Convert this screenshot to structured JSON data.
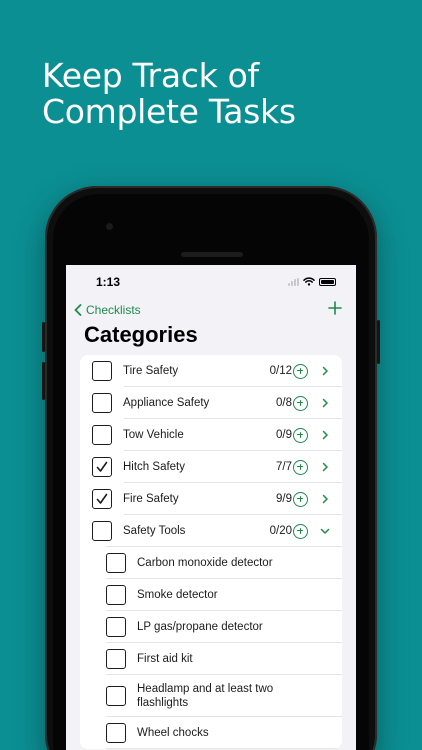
{
  "headline": {
    "line1": "Keep Track of",
    "line2": "Complete Tasks"
  },
  "status_bar": {
    "time": "1:13"
  },
  "nav": {
    "back_label": "Checklists",
    "title": "Categories"
  },
  "icons": {
    "back": "chevron-left-icon",
    "add": "plus-icon",
    "item_add": "plus-circle-icon",
    "disclosure": "chevron-right-icon",
    "expanded": "chevron-down-icon",
    "check": "checkmark-icon"
  },
  "colors": {
    "background": "#0b8f93",
    "accent": "#1e8a4c"
  },
  "categories": [
    {
      "label": "Tire Safety",
      "count": "0/12",
      "checked": false,
      "expanded": false
    },
    {
      "label": "Appliance Safety",
      "count": "0/8",
      "checked": false,
      "expanded": false
    },
    {
      "label": "Tow Vehicle",
      "count": "0/9",
      "checked": false,
      "expanded": false
    },
    {
      "label": "Hitch Safety",
      "count": "7/7",
      "checked": true,
      "expanded": false
    },
    {
      "label": "Fire Safety",
      "count": "9/9",
      "checked": true,
      "expanded": false
    },
    {
      "label": "Safety Tools",
      "count": "0/20",
      "checked": false,
      "expanded": true
    }
  ],
  "safety_tools_items": [
    {
      "label": "Carbon monoxide detector",
      "checked": false
    },
    {
      "label": "Smoke detector",
      "checked": false
    },
    {
      "label": "LP gas/propane detector",
      "checked": false
    },
    {
      "label": "First aid kit",
      "checked": false
    },
    {
      "label": "Headlamp and at least two flashlights",
      "checked": false
    },
    {
      "label": "Wheel chocks",
      "checked": false
    }
  ]
}
